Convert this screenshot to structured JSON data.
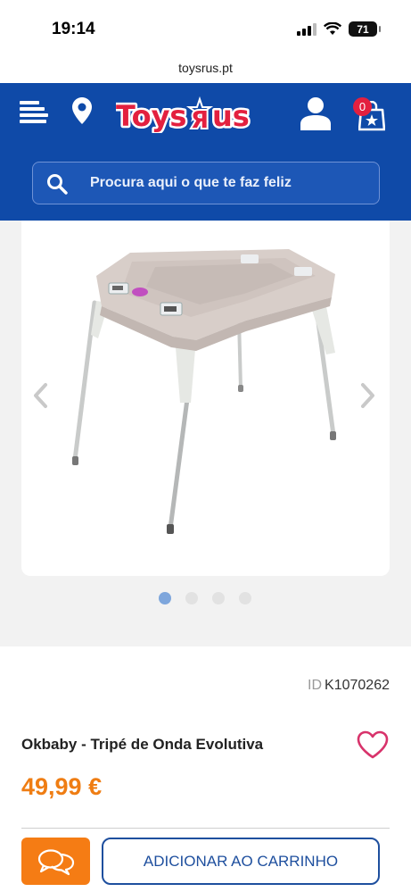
{
  "status_bar": {
    "time": "19:14",
    "battery": "71"
  },
  "browser": {
    "url": "toysrus.pt"
  },
  "header": {
    "logo_text": "ToysRus",
    "cart_count": "0",
    "search_placeholder": "Procura aqui o que te faz feliz",
    "brand_color": "#0f4aa8",
    "badge_color": "#e3203f"
  },
  "gallery": {
    "image_count": 4,
    "active_index": 0
  },
  "product": {
    "id_label": "ID",
    "id_value": "K1070262",
    "title": "Okbaby - Tripé de Onda Evolutiva",
    "price": "49,99 €",
    "price_color": "#ef7d13"
  },
  "actions": {
    "add_to_cart_label": "ADICIONAR AO CARRINHO",
    "chat_button_color": "#f57c14"
  },
  "icons": [
    "menu-icon",
    "location-pin-icon",
    "user-icon",
    "shopping-bag-icon",
    "search-icon",
    "chevron-left-icon",
    "chevron-right-icon",
    "heart-icon",
    "chat-bubbles-icon"
  ]
}
